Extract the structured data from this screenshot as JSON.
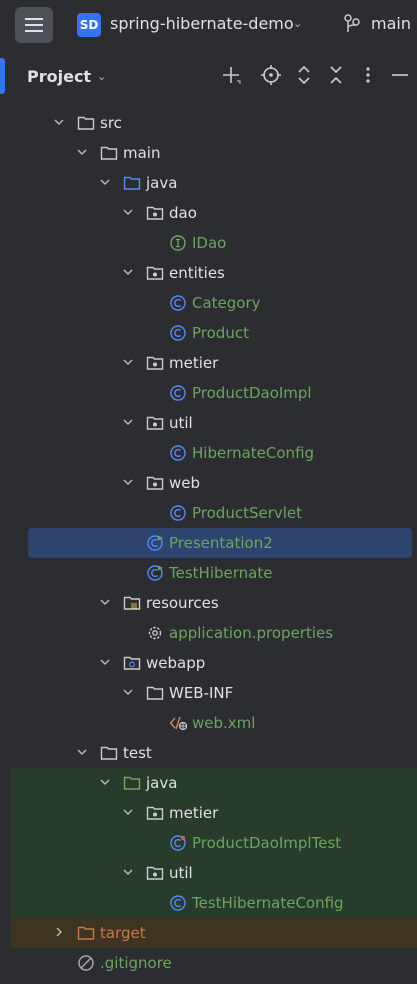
{
  "window": {
    "project_badge": "SD",
    "project_name": "spring-hibernate-demo",
    "branch": "main"
  },
  "panel": {
    "title": "Project"
  },
  "colors": {
    "selection": "#2e436e",
    "test_bg": "#293b2a",
    "excluded_bg": "#3f3322",
    "accent": "#3574f0"
  },
  "tree": [
    {
      "label": "src",
      "icon": "folder-icon",
      "expanded": true
    },
    {
      "label": "main",
      "icon": "folder-icon",
      "expanded": true
    },
    {
      "label": "java",
      "icon": "source-folder-icon",
      "expanded": true
    },
    {
      "label": "dao",
      "icon": "package-icon",
      "expanded": true
    },
    {
      "label": "IDao",
      "icon": "interface-icon"
    },
    {
      "label": "entities",
      "icon": "package-icon",
      "expanded": true
    },
    {
      "label": "Category",
      "icon": "class-icon"
    },
    {
      "label": "Product",
      "icon": "class-icon"
    },
    {
      "label": "metier",
      "icon": "package-icon",
      "expanded": true
    },
    {
      "label": "ProductDaoImpl",
      "icon": "class-icon"
    },
    {
      "label": "util",
      "icon": "package-icon",
      "expanded": true
    },
    {
      "label": "HibernateConfig",
      "icon": "class-icon"
    },
    {
      "label": "web",
      "icon": "package-icon",
      "expanded": true
    },
    {
      "label": "ProductServlet",
      "icon": "class-icon"
    },
    {
      "label": "Presentation2",
      "icon": "runnable-class-icon",
      "selected": true
    },
    {
      "label": "TestHibernate",
      "icon": "runnable-class-icon"
    },
    {
      "label": "resources",
      "icon": "resources-folder-icon",
      "expanded": true
    },
    {
      "label": "application.properties",
      "icon": "gear-icon"
    },
    {
      "label": "webapp",
      "icon": "web-folder-icon",
      "expanded": true
    },
    {
      "label": "WEB-INF",
      "icon": "folder-icon",
      "expanded": true
    },
    {
      "label": "web.xml",
      "icon": "xml-file-icon"
    },
    {
      "label": "test",
      "icon": "folder-icon",
      "expanded": true
    },
    {
      "label": "java",
      "icon": "test-source-folder-icon",
      "expanded": true
    },
    {
      "label": "metier",
      "icon": "package-icon",
      "expanded": true
    },
    {
      "label": "ProductDaoImplTest",
      "icon": "test-class-icon"
    },
    {
      "label": "util",
      "icon": "package-icon",
      "expanded": true
    },
    {
      "label": "TestHibernateConfig",
      "icon": "class-icon"
    },
    {
      "label": "target",
      "icon": "excluded-folder-icon",
      "expanded": false
    },
    {
      "label": ".gitignore",
      "icon": "ignored-file-icon"
    }
  ]
}
